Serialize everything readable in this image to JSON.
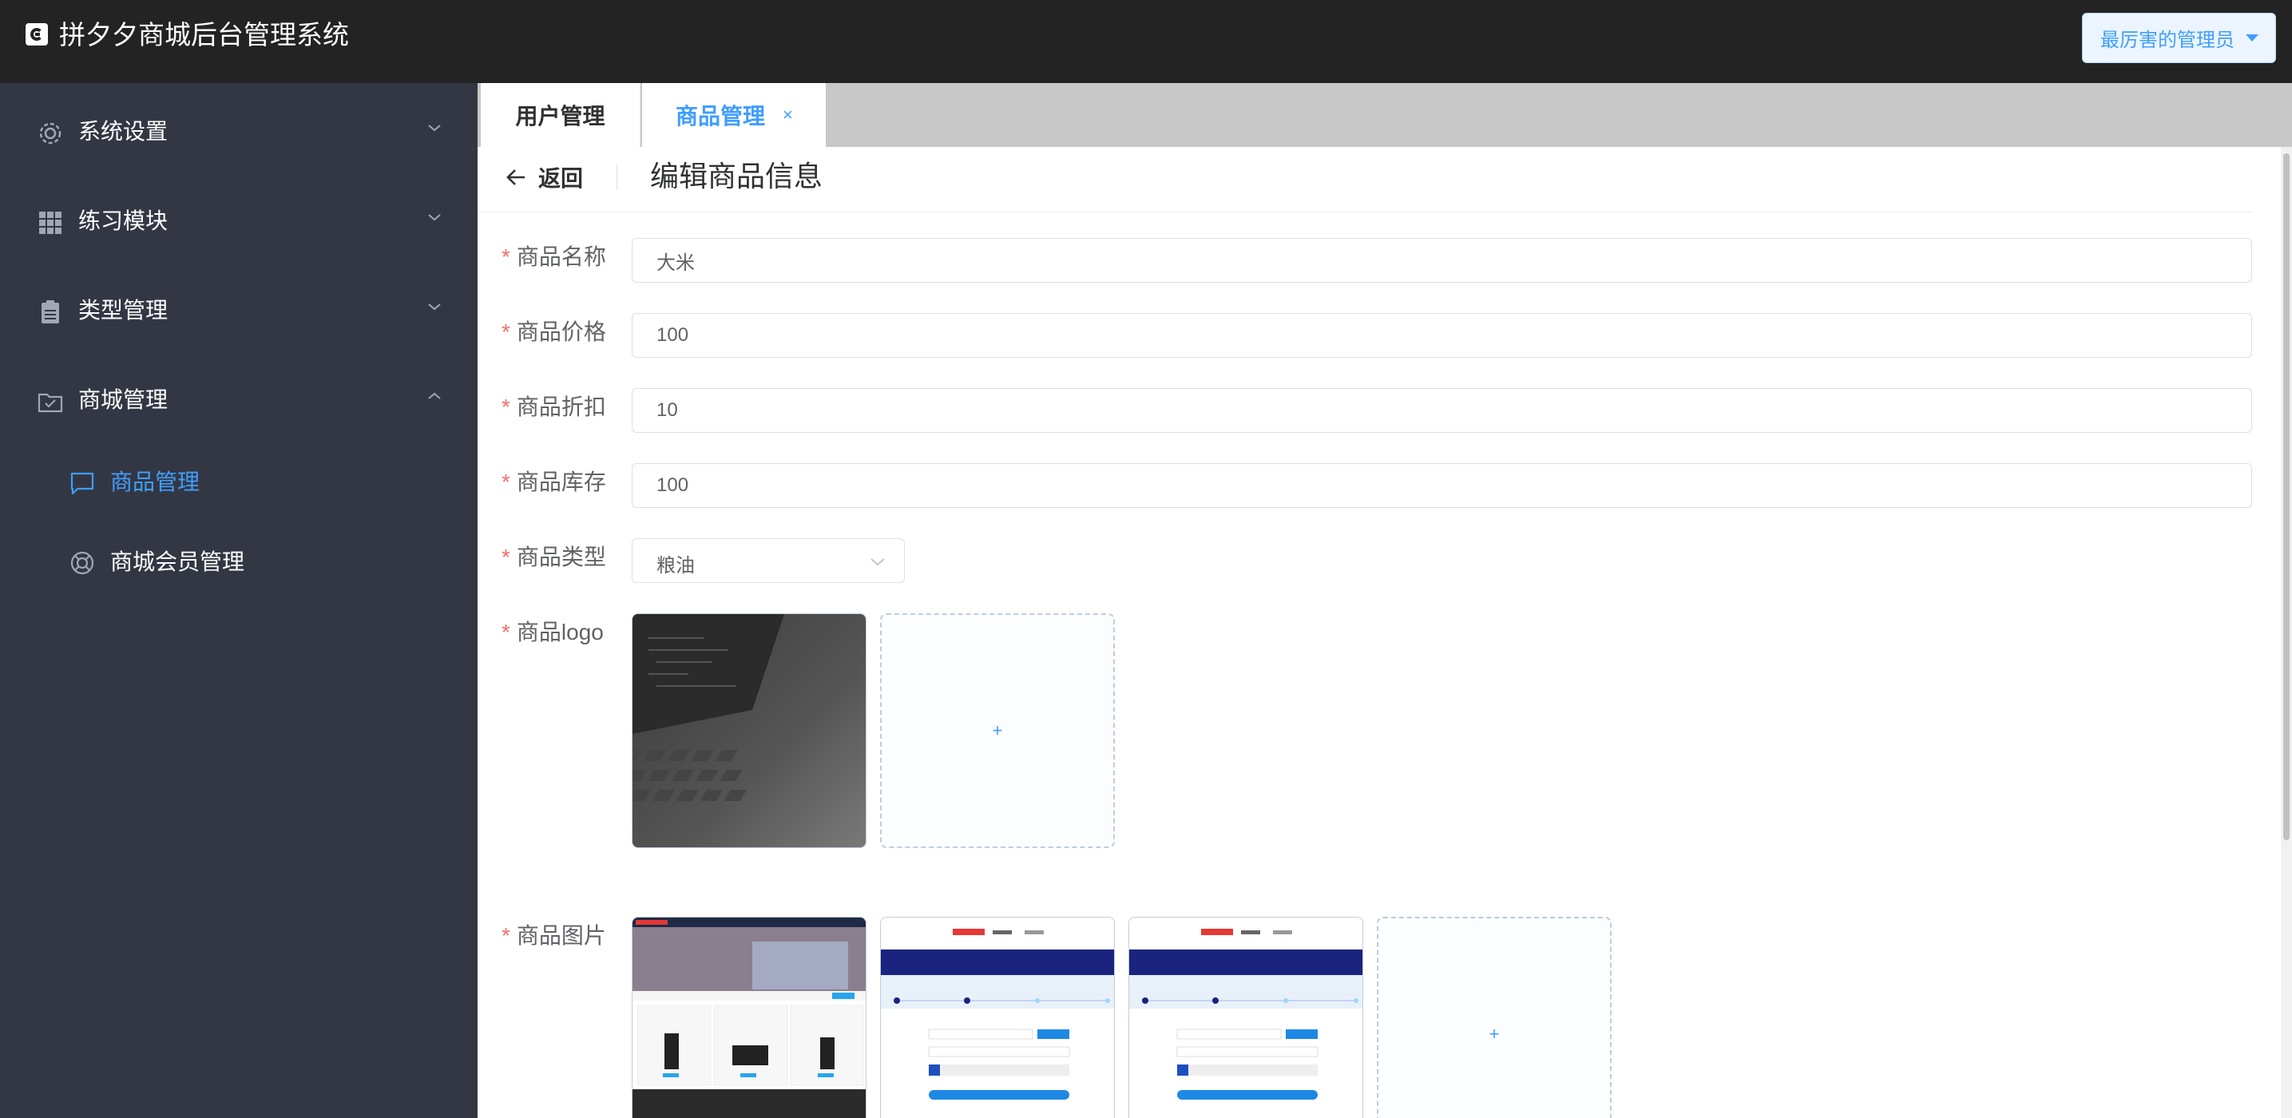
{
  "header": {
    "app_title": "拼夕夕商城后台管理系统",
    "user_button": "最厉害的管理员"
  },
  "sidebar": {
    "menus": [
      {
        "label": "系统设置",
        "icon": "gear-icon",
        "expanded": false
      },
      {
        "label": "练习模块",
        "icon": "grid-icon",
        "expanded": false
      },
      {
        "label": "类型管理",
        "icon": "clipboard-icon",
        "expanded": false
      },
      {
        "label": "商城管理",
        "icon": "folder-check-icon",
        "expanded": true
      }
    ],
    "sub_items": [
      {
        "label": "商品管理",
        "icon": "chat-icon",
        "active": true
      },
      {
        "label": "商城会员管理",
        "icon": "lifebuoy-icon",
        "active": false
      }
    ]
  },
  "tabs": [
    {
      "label": "用户管理",
      "active": false
    },
    {
      "label": "商品管理",
      "active": true,
      "close": "×"
    }
  ],
  "page": {
    "back_label": "返回",
    "title": "编辑商品信息"
  },
  "form": {
    "required_mark": "*",
    "name": {
      "label": "商品名称",
      "value": "大米"
    },
    "price": {
      "label": "商品价格",
      "value": "100"
    },
    "discount": {
      "label": "商品折扣",
      "value": "10"
    },
    "stock": {
      "label": "商品库存",
      "value": "100"
    },
    "type": {
      "label": "商品类型",
      "value": "粮油"
    },
    "logo": {
      "label": "商品logo",
      "add_symbol": "+"
    },
    "images": {
      "label": "商品图片",
      "add_symbol": "+",
      "count": 3
    }
  },
  "colors": {
    "header_bg": "#232323",
    "sidebar_bg": "#333744",
    "accent": "#409eff",
    "required": "#f56c6c"
  }
}
